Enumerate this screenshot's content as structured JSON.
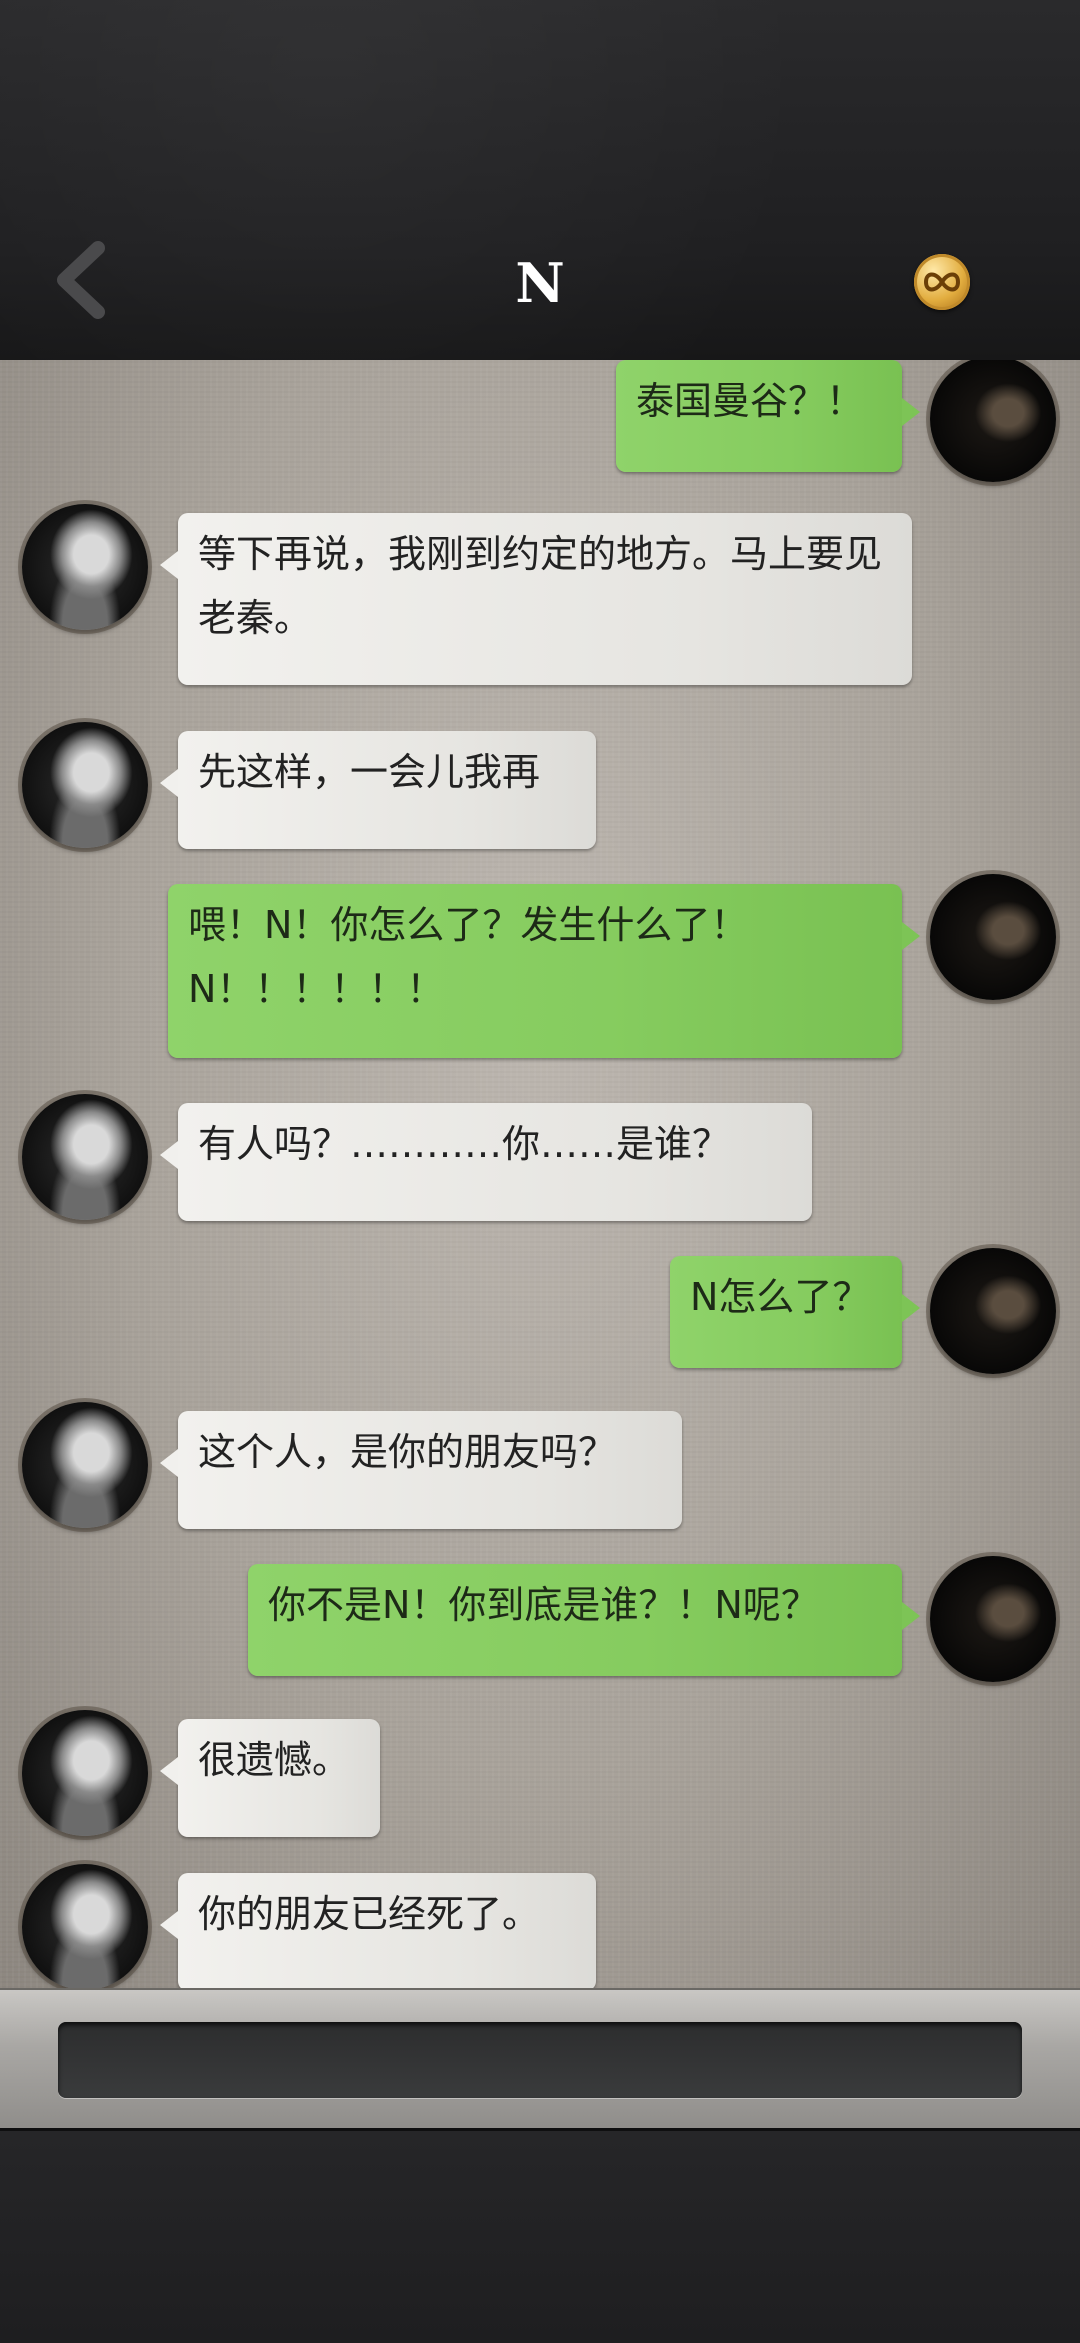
{
  "header": {
    "title": "N",
    "back_icon": "chevron-left-icon",
    "coin_icon": "infinity-coin-icon",
    "colors": {
      "header_bg": "#232325",
      "title": "#ffffff",
      "coin": "#e2ad3f"
    }
  },
  "messages": [
    {
      "side": "right",
      "text": "泰国曼谷？！"
    },
    {
      "side": "left",
      "text": "等下再说，我刚到约定的地方。马上要见老秦。"
    },
    {
      "side": "left",
      "text": "先这样，一会儿我再"
    },
    {
      "side": "right",
      "text": "喂！N！你怎么了？发生什么了！N！！！！！！"
    },
    {
      "side": "left",
      "text": "有人吗？…………你……是谁？"
    },
    {
      "side": "right",
      "text": "N怎么了？"
    },
    {
      "side": "left",
      "text": "这个人，是你的朋友吗？"
    },
    {
      "side": "right",
      "text": "你不是N！你到底是谁？！N呢？"
    },
    {
      "side": "left",
      "text": "很遗憾。"
    },
    {
      "side": "left",
      "text": "你的朋友已经死了。"
    }
  ],
  "colors": {
    "bubble_me": "#86cc5f",
    "bubble_them": "#eceae6",
    "input_bg": "#333435"
  },
  "input": {
    "value": "",
    "placeholder": ""
  }
}
